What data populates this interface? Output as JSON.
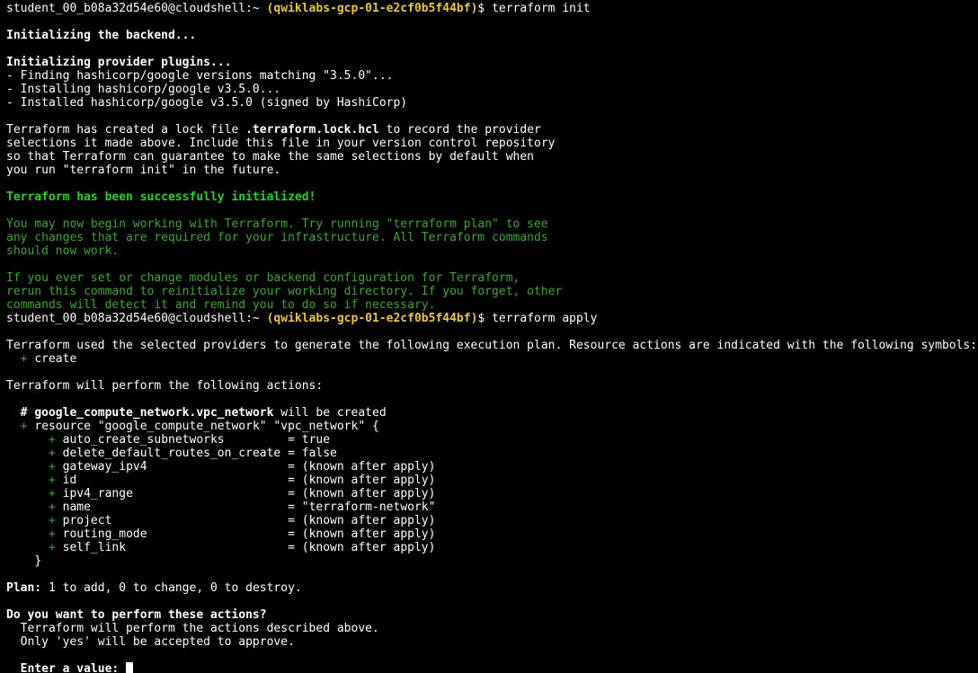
{
  "terminal": {
    "prompt_user": "student_00_b08a32d54e60@cloudshell:~",
    "prompt_project": "(qwiklabs-gcp-01-e2cf0b5f44bf)",
    "prompt_symbol": "$",
    "cmd_init": "terraform init",
    "cmd_apply": "terraform apply",
    "init_backend": "Initializing the backend...",
    "init_plugins": "Initializing provider plugins...",
    "finding": "- Finding hashicorp/google versions matching \"3.5.0\"...",
    "installing": "- Installing hashicorp/google v3.5.0...",
    "installed": "- Installed hashicorp/google v3.5.0 (signed by HashiCorp)",
    "lock_1a": "Terraform has created a lock file ",
    "lock_1b": ".terraform.lock.hcl",
    "lock_1c": " to record the provider",
    "lock_2": "selections it made above. Include this file in your version control repository",
    "lock_3": "so that Terraform can guarantee to make the same selections by default when",
    "lock_4": "you run \"terraform init\" in the future.",
    "success": "Terraform has been successfully initialized!",
    "begin_1": "You may now begin working with Terraform. Try running \"terraform plan\" to see",
    "begin_2": "any changes that are required for your infrastructure. All Terraform commands",
    "begin_3": "should now work.",
    "modules_1": "If you ever set or change modules or backend configuration for Terraform,",
    "modules_2": "rerun this command to reinitialize your working directory. If you forget, other",
    "modules_3": "commands will detect it and remind you to do so if necessary.",
    "plan_intro": "Terraform used the selected providers to generate the following execution plan. Resource actions are indicated with the following symbols:",
    "symbol_create_plus": "+",
    "symbol_create_label": "create",
    "perform": "Terraform will perform the following actions:",
    "resource_comment_hash": "#",
    "resource_comment_name": "google_compute_network.vpc_network",
    "resource_comment_rest": " will be created",
    "resource_decl_plus": "+",
    "resource_decl": "resource \"google_compute_network\" \"vpc_network\" {",
    "attributes": [
      {
        "name": "auto_create_subnetworks        ",
        "value": "= true"
      },
      {
        "name": "delete_default_routes_on_create",
        "value": "= false"
      },
      {
        "name": "gateway_ipv4                   ",
        "value": "= (known after apply)"
      },
      {
        "name": "id                             ",
        "value": "= (known after apply)"
      },
      {
        "name": "ipv4_range                     ",
        "value": "= (known after apply)"
      },
      {
        "name": "name                           ",
        "value": "= \"terraform-network\""
      },
      {
        "name": "project                        ",
        "value": "= (known after apply)"
      },
      {
        "name": "routing_mode                   ",
        "value": "= (known after apply)"
      },
      {
        "name": "self_link                      ",
        "value": "= (known after apply)"
      }
    ],
    "attr_plus": "+",
    "close_brace": "}",
    "plan_label": "Plan:",
    "plan_summary": " 1 to add, 0 to change, 0 to destroy.",
    "question": "Do you want to perform these actions?",
    "question_1": "Terraform will perform the actions described above.",
    "question_2": "Only 'yes' will be accepted to approve.",
    "enter_label": "Enter a value:",
    "input_value": ""
  },
  "colors": {
    "background": "#000000",
    "text": "#ffffff",
    "success_green": "#2ad12a",
    "info_green": "#43a535",
    "project_yellow": "#e6c74a"
  }
}
